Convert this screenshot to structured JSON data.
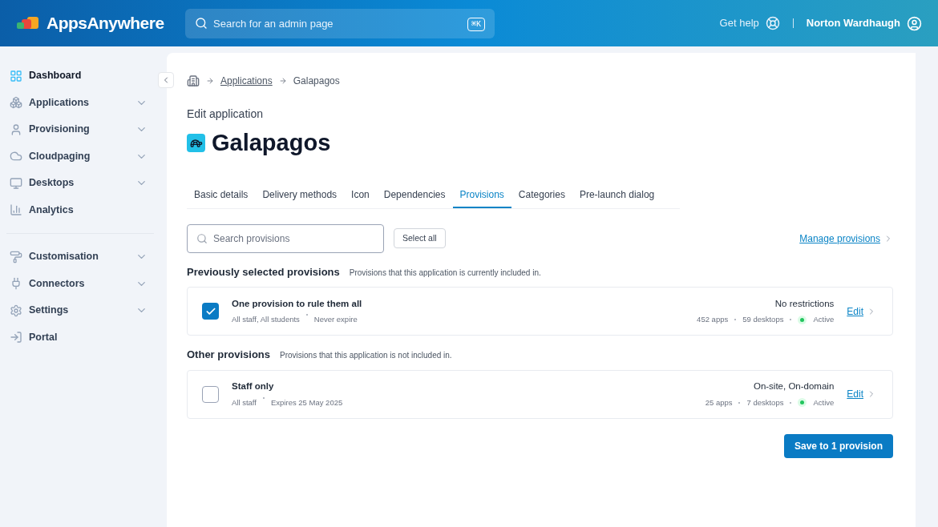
{
  "header": {
    "logo_text": "AppsAnywhere",
    "search": {
      "placeholder": "Search for an admin page",
      "shortcut": "⌘K"
    },
    "help_label": "Get help",
    "user_name": "Norton Wardhaugh"
  },
  "sidebar": {
    "groups": [
      {
        "items": [
          {
            "label": "Dashboard",
            "selected": true,
            "expandable": false
          },
          {
            "label": "Applications",
            "selected": false,
            "expandable": true
          },
          {
            "label": "Provisioning",
            "selected": false,
            "expandable": true
          },
          {
            "label": "Cloudpaging",
            "selected": false,
            "expandable": true
          },
          {
            "label": "Desktops",
            "selected": false,
            "expandable": true
          },
          {
            "label": "Analytics",
            "selected": false,
            "expandable": false
          }
        ]
      },
      {
        "items": [
          {
            "label": "Customisation",
            "selected": false,
            "expandable": true
          },
          {
            "label": "Connectors",
            "selected": false,
            "expandable": true
          },
          {
            "label": "Settings",
            "selected": false,
            "expandable": true
          },
          {
            "label": "Portal",
            "selected": false,
            "expandable": false
          }
        ]
      }
    ]
  },
  "breadcrumb": [
    {
      "label": "Applications",
      "link": true
    },
    {
      "label": "Galapagos",
      "link": false
    }
  ],
  "page": {
    "subtitle": "Edit application",
    "title": "Galapagos"
  },
  "tabs": [
    {
      "label": "Basic details",
      "selected": false
    },
    {
      "label": "Delivery methods",
      "selected": false
    },
    {
      "label": "Icon",
      "selected": false
    },
    {
      "label": "Dependencies",
      "selected": false
    },
    {
      "label": "Provisions",
      "selected": true
    },
    {
      "label": "Categories",
      "selected": false
    },
    {
      "label": "Pre-launch dialog",
      "selected": false
    }
  ],
  "toolbar": {
    "search": {
      "placeholder": "Search provisions"
    },
    "select_all": "Select all",
    "manage_link": "Manage provisions"
  },
  "sections": [
    {
      "title": "Previously selected provisions",
      "description": "Provisions that this application is currently included in.",
      "items": [
        {
          "name": "One provision to rule them all",
          "checked": true,
          "audience": "All staff, All students",
          "expiry": "Never expire",
          "restriction": "No restrictions",
          "apps": "452 apps",
          "desktops": "59 desktops",
          "status": "Active",
          "color": "#22c55e",
          "edit": "Edit"
        }
      ]
    },
    {
      "title": "Other provisions",
      "description": "Provisions that this application is not included in.",
      "items": [
        {
          "name": "Staff only",
          "checked": false,
          "audience": "All staff",
          "expiry": "Expires 25 May 2025",
          "restriction": "On-site, On-domain",
          "apps": "25 apps",
          "desktops": "7 desktops",
          "status": "Active",
          "color": "#22c55e",
          "edit": "Edit"
        }
      ]
    }
  ],
  "save_button": "Save to 1 provision"
}
